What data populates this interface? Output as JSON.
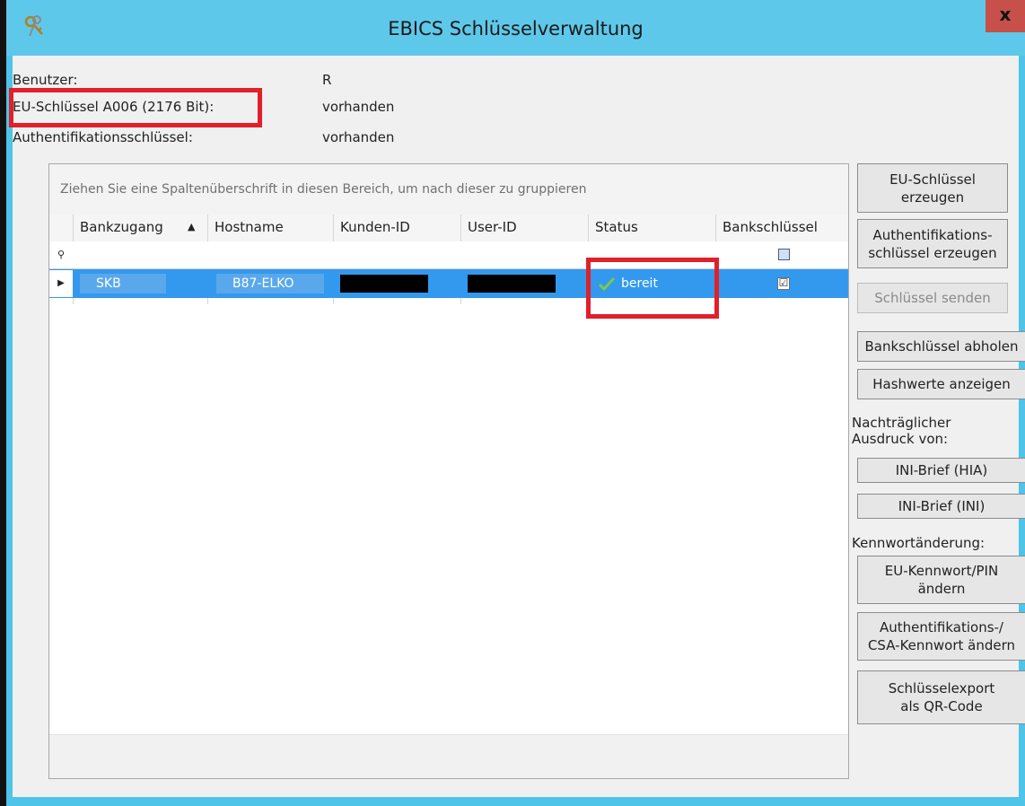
{
  "window": {
    "title": "EBICS Schlüsselverwaltung",
    "close_label": "x"
  },
  "info": {
    "user_label": "Benutzer:",
    "user_value": "R",
    "eu_key_label": "EU-Schlüssel A006 (2176 Bit):",
    "eu_key_value": "vorhanden",
    "auth_key_label": "Authentifikationsschlüssel:",
    "auth_key_value": "vorhanden"
  },
  "grid": {
    "group_hint": "Ziehen Sie eine Spaltenüberschrift in diesen Bereich, um nach dieser zu gruppieren",
    "columns": [
      "Bankzugang",
      "Hostname",
      "Kunden-ID",
      "User-ID",
      "Status",
      "Bankschlüssel"
    ],
    "sort_indicator": "▲",
    "filter_indicator": "⚲",
    "row_indicator": "▶",
    "rows": [
      {
        "bankzugang": "SKB",
        "hostname": "B87-ELKO",
        "kunden_id": "",
        "user_id": "",
        "status": "bereit",
        "bankschluessel": "☑"
      }
    ]
  },
  "buttons": {
    "eu_key_create": "EU-Schlüssel\nerzeugen",
    "auth_key_create": "Authentifikations-\nschlüssel erzeugen",
    "send_keys": "Schlüssel senden",
    "fetch_bank_keys": "Bankschlüssel abholen",
    "show_hashes": "Hashwerte anzeigen",
    "ini_hia": "INI-Brief (HIA)",
    "ini_ini": "INI-Brief (INI)",
    "eu_password": "EU-Kennwort/PIN\nändern",
    "auth_password": "Authentifikations-/\nCSA-Kennwort ändern",
    "key_export": "Schlüsselexport\nals QR-Code"
  },
  "side_labels": {
    "reprint": "Nachträglicher\nAusdruck von:",
    "password_change": "Kennwortänderung:"
  },
  "colors": {
    "title_bar": "#5ec8ea",
    "selection": "#3399ee",
    "highlight": "#e0202a"
  }
}
